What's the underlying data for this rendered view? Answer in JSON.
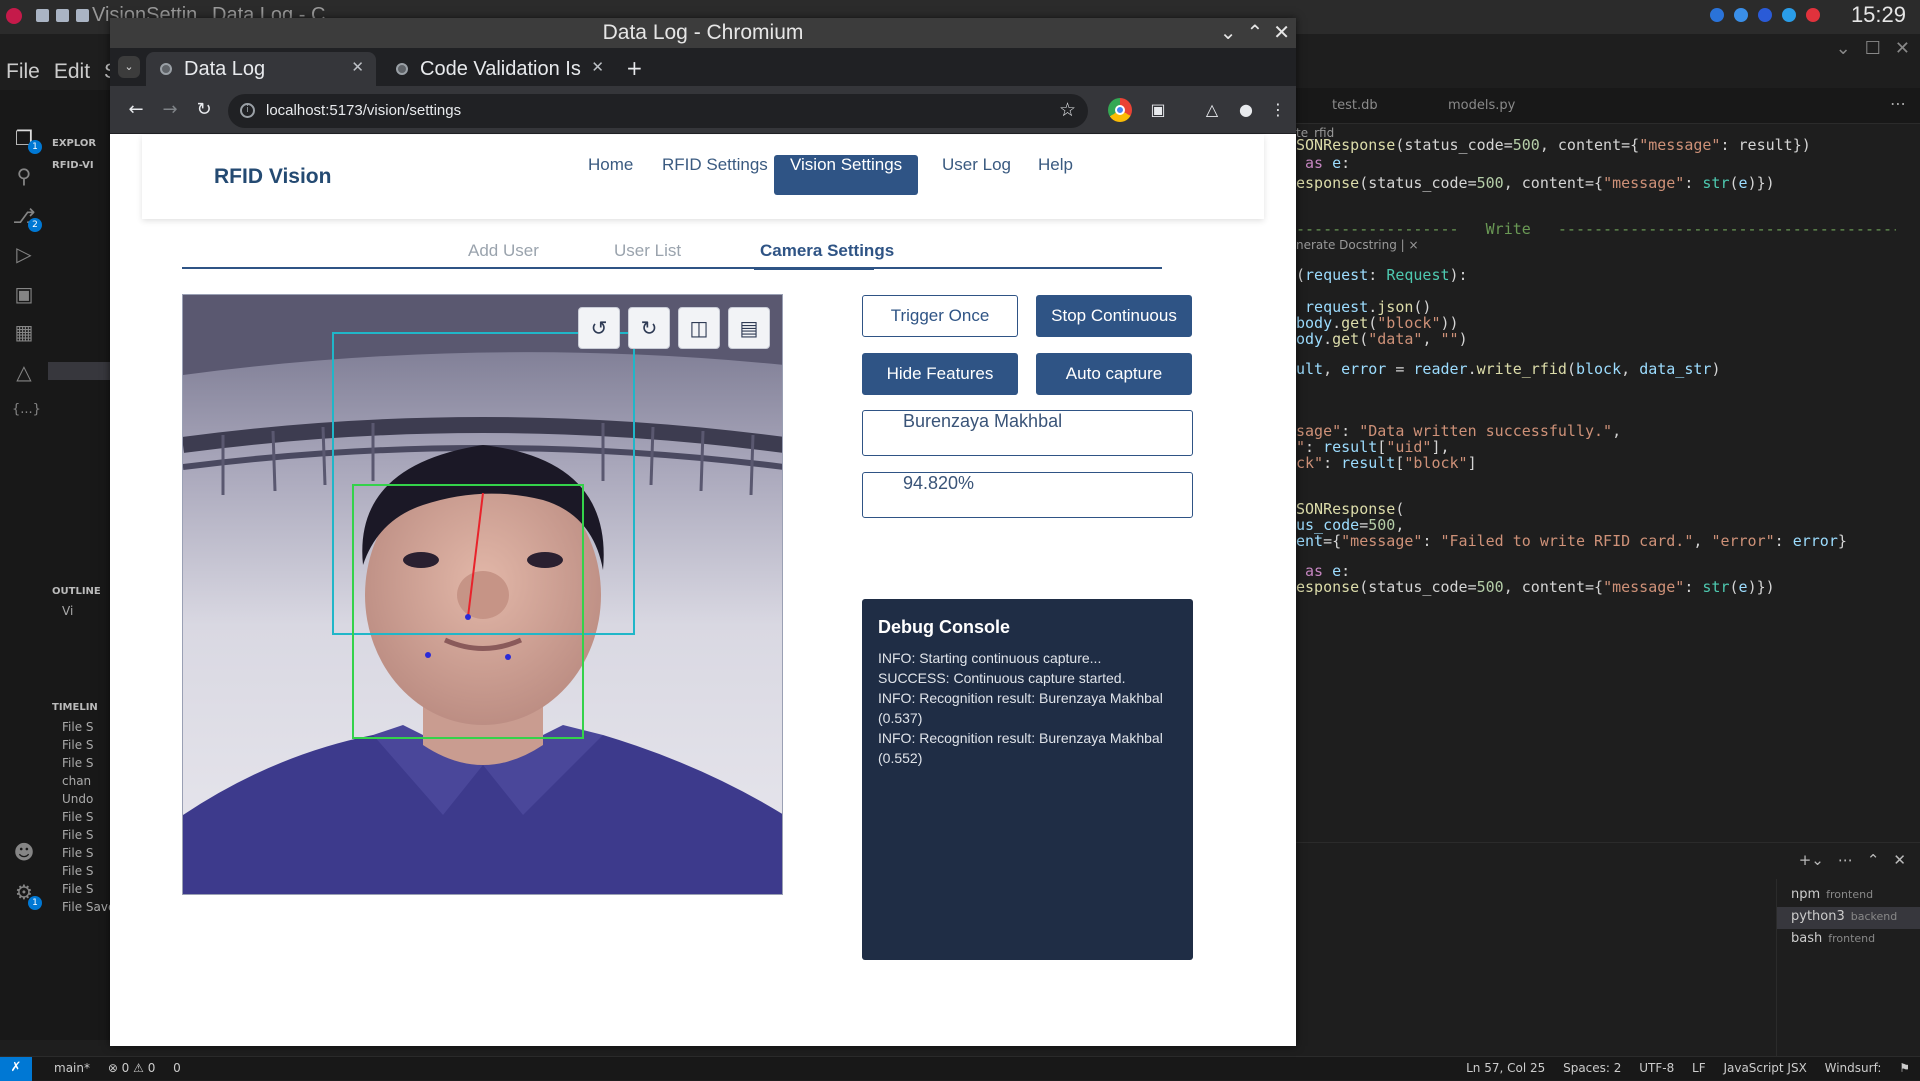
{
  "os": {
    "task1": "VisionSettin",
    "task2": "Data Log - C",
    "clock": "15:29"
  },
  "vscode": {
    "menu": [
      "File",
      "Edit",
      "S"
    ],
    "sidebar": {
      "explorer": "EXPLOR",
      "project": "RFID-VI",
      "outline": "OUTLINE",
      "outline_item": "Vi",
      "timeline": "TIMELIN",
      "timeline_items": [
        "File S",
        "File S",
        "File S",
        "chan",
        "Undo",
        "File S",
        "File S",
        "File S",
        "File S",
        "File S",
        "File Saved"
      ]
    },
    "badges": {
      "explorer": "1",
      "scm": "2",
      "accounts": "1"
    },
    "editor_tabs": [
      "test.db",
      "models.py"
    ],
    "breadcrumb": "te_rfid",
    "code_hint": "nerate Docstring | ×",
    "terminals": [
      {
        "name": "npm",
        "sub": "frontend"
      },
      {
        "name": "python3",
        "sub": "backend"
      },
      {
        "name": "bash",
        "sub": "frontend"
      }
    ],
    "status": {
      "branch": "main*",
      "problems": "⊗ 0 ⚠ 0",
      "ports": "0",
      "position": "Ln 57, Col 25",
      "spaces": "Spaces: 2",
      "encoding": "UTF-8",
      "eol": "LF",
      "language": "JavaScript JSX",
      "extension": "Windsurf: "
    }
  },
  "browser": {
    "window_title": "Data Log - Chromium",
    "tabs": [
      {
        "label": "Data Log"
      },
      {
        "label": "Code Validation Is"
      }
    ],
    "url": "localhost:5173/vision/settings"
  },
  "app": {
    "brand": "RFID Vision",
    "nav": [
      "Home",
      "RFID Settings",
      "Vision Settings",
      "User Log",
      "Help"
    ],
    "active_nav": "Vision Settings",
    "subtabs": [
      "Add User",
      "User List",
      "Camera Settings"
    ],
    "active_subtab": "Camera Settings",
    "buttons": {
      "trigger_once": "Trigger Once",
      "stop_continuous": "Stop Continuous",
      "hide_features": "Hide Features",
      "auto_capture": "Auto capture"
    },
    "recognized_name": "Burenzaya Makhbal",
    "confidence": "94.820%",
    "debug": {
      "title": "Debug Console",
      "lines": [
        "INFO: Starting continuous capture...",
        "SUCCESS: Continuous capture started.",
        "INFO: Recognition result: Burenzaya Makhbal (0.537)",
        "INFO: Recognition result: Burenzaya Makhbal (0.552)"
      ]
    }
  }
}
